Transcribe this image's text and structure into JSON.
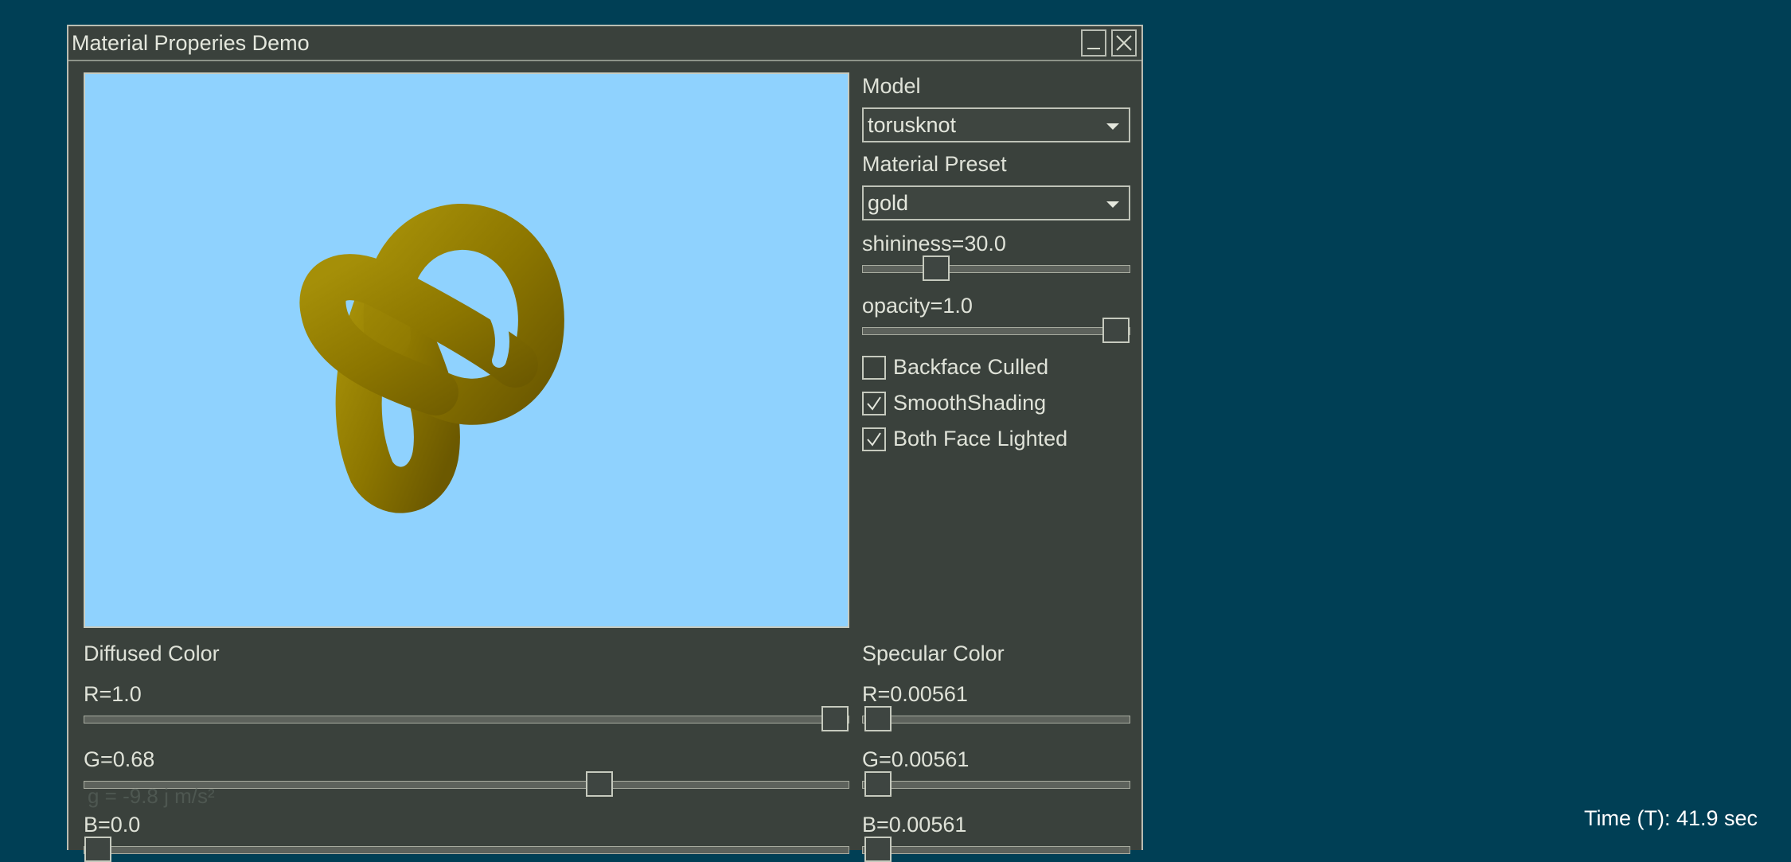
{
  "window": {
    "title": "Material Properies Demo",
    "minimize_icon": "minimize-icon",
    "close_icon": "close-icon"
  },
  "viewport": {
    "background": "#8fd2fe",
    "model_color": "#8f7a00",
    "object": "torus knot"
  },
  "panel": {
    "model_label": "Model",
    "model_value": "torusknot",
    "preset_label": "Material Preset",
    "preset_value": "gold",
    "shininess_label": "shininess=30.0",
    "shininess_fraction": 0.25,
    "opacity_label": "opacity=1.0",
    "opacity_fraction": 1.0,
    "checkboxes": [
      {
        "label": "Backface Culled",
        "checked": false
      },
      {
        "label": "SmoothShading",
        "checked": true
      },
      {
        "label": "Both Face Lighted",
        "checked": true
      }
    ]
  },
  "diffuse": {
    "title": "Diffused Color",
    "r_label": "R=1.0",
    "r": 1.0,
    "g_label": "G=0.68",
    "g": 0.68,
    "b_label": "B=0.0",
    "b": 0.0
  },
  "specular": {
    "title": "Specular Color",
    "r_label": "R=0.00561",
    "r": 0.00561,
    "g_label": "G=0.00561",
    "g": 0.00561,
    "b_label": "B=0.00561",
    "b": 0.00561
  },
  "background_text": "g = -9.8 j m/s²",
  "status": "Time (T): 41.9 sec",
  "colors": {
    "desktop": "#003f55",
    "window": "#3a413c",
    "text": "#dfe2d8"
  }
}
